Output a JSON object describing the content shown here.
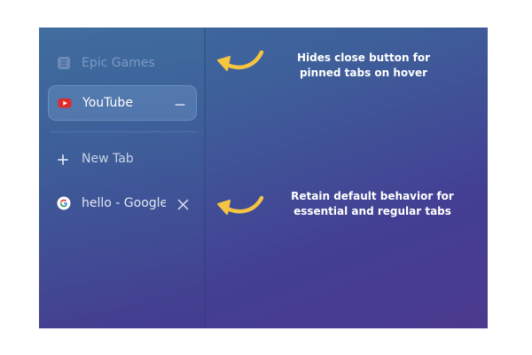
{
  "sidebar": {
    "pinned_tabs": [
      {
        "label": "Epic Games",
        "icon": "epic-games-icon",
        "state": "dimmed"
      },
      {
        "label": "YouTube",
        "icon": "youtube-icon",
        "state": "active",
        "action_icon": "unpin-minus-icon"
      }
    ],
    "new_tab": {
      "label": "New Tab",
      "icon": "plus-icon"
    },
    "regular_tabs": [
      {
        "label": "hello - Google Search",
        "icon": "google-icon",
        "close_icon": "close-icon"
      }
    ]
  },
  "annotations": [
    {
      "text_line1": "Hides close button for",
      "text_line2": "pinned tabs on hover"
    },
    {
      "text_line1": "Retain default behavior for",
      "text_line2": "essential and regular tabs"
    }
  ],
  "colors": {
    "arrow": "#f5c542",
    "youtube_red": "#e02b2b",
    "background_top": "#3f6b9e",
    "background_bottom": "#4b3a8e"
  }
}
